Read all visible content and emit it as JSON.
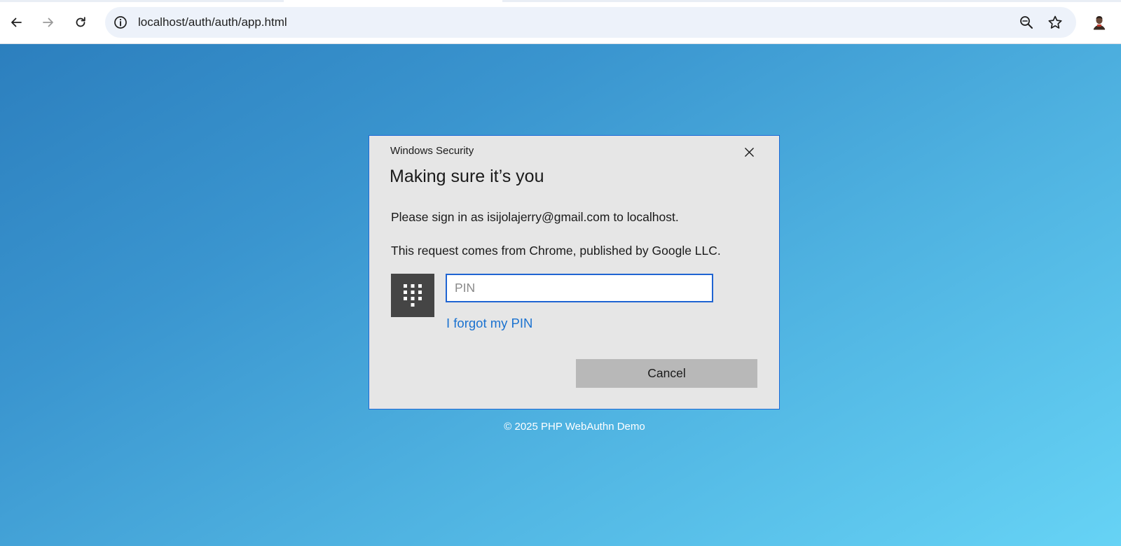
{
  "browser": {
    "url": "localhost/auth/auth/app.html",
    "icons": {
      "back": "back-arrow-icon",
      "forward": "forward-arrow-icon",
      "reload": "reload-icon",
      "site_info": "site-info-icon",
      "zoom": "zoom-icon",
      "bookmark": "star-icon",
      "profile": "profile-avatar"
    }
  },
  "dialog": {
    "caption": "Windows Security",
    "title": "Making sure it’s you",
    "line1": "Please sign in as isijolajerry@gmail.com to localhost.",
    "line2": "This request comes from Chrome, published by Google LLC.",
    "pin_placeholder": "PIN",
    "pin_value": "",
    "forgot_label": "I forgot my PIN",
    "cancel_label": "Cancel",
    "accent_color": "#1f64d2",
    "link_color": "#1b72d0"
  },
  "footer": {
    "text": "© 2025 PHP WebAuthn Demo"
  }
}
